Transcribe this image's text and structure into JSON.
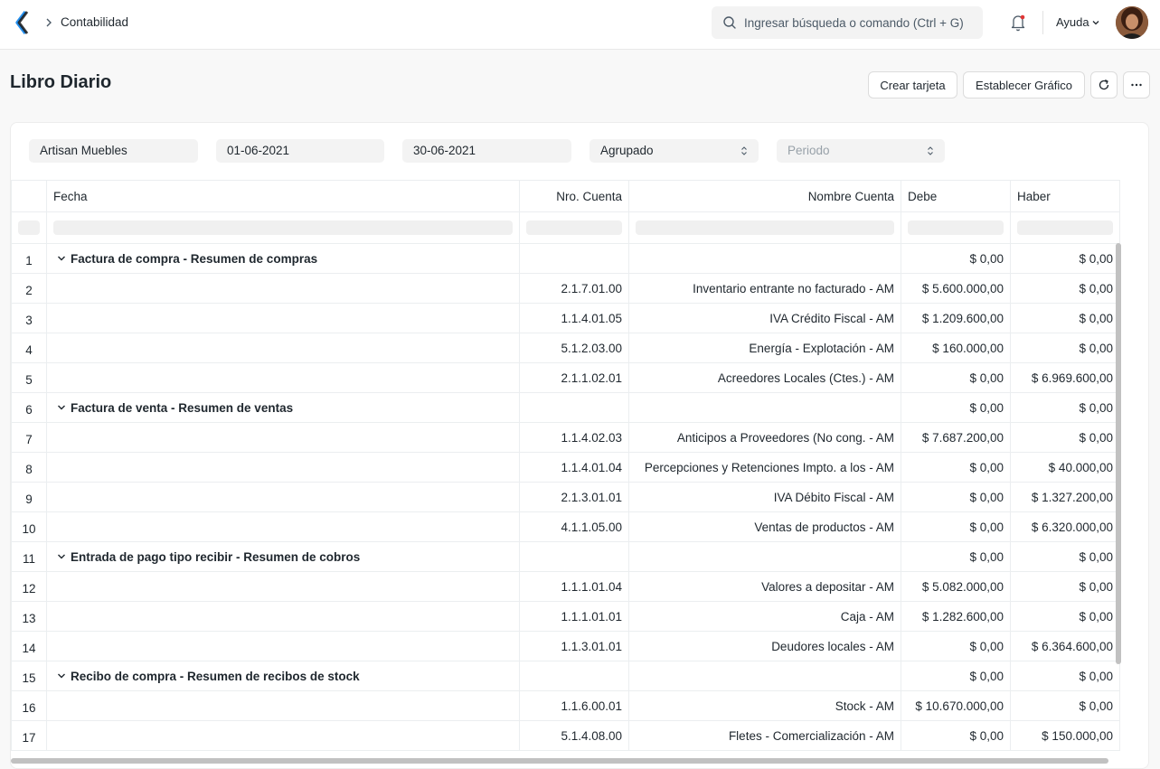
{
  "navbar": {
    "breadcrumb": "Contabilidad",
    "search_placeholder": "Ingresar búsqueda o comando (Ctrl + G)",
    "help_label": "Ayuda",
    "colors": {
      "brand": "#2490ef",
      "accent": "#171717"
    }
  },
  "page": {
    "title": "Libro Diario",
    "buttons": {
      "create_card": "Crear tarjeta",
      "set_chart": "Establecer Gráfico",
      "refresh_icon": "refresh-icon",
      "more_icon": "more-icon"
    }
  },
  "filters": {
    "company": "Artisan Muebles",
    "from_date": "01-06-2021",
    "to_date": "30-06-2021",
    "group_by": "Agrupado",
    "period_placeholder": "Periodo"
  },
  "table": {
    "columns": [
      "Fecha",
      "Nro. Cuenta",
      "Nombre Cuenta",
      "Debe",
      "Haber"
    ],
    "rows": [
      {
        "n": "1",
        "fecha": "Factura de compra - Resumen de compras",
        "cuenta": "",
        "nombre": "",
        "debe": "$ 0,00",
        "haber": "$ 0,00"
      },
      {
        "n": "2",
        "fecha": "",
        "cuenta": "2.1.7.01.00",
        "nombre": "Inventario entrante no facturado - AM",
        "debe": "$ 5.600.000,00",
        "haber": "$ 0,00"
      },
      {
        "n": "3",
        "fecha": "",
        "cuenta": "1.1.4.01.05",
        "nombre": "IVA Crédito Fiscal - AM",
        "debe": "$ 1.209.600,00",
        "haber": "$ 0,00"
      },
      {
        "n": "4",
        "fecha": "",
        "cuenta": "5.1.2.03.00",
        "nombre": "Energía - Explotación - AM",
        "debe": "$ 160.000,00",
        "haber": "$ 0,00"
      },
      {
        "n": "5",
        "fecha": "",
        "cuenta": "2.1.1.02.01",
        "nombre": "Acreedores Locales (Ctes.) - AM",
        "debe": "$ 0,00",
        "haber": "$ 6.969.600,00"
      },
      {
        "n": "6",
        "fecha": "Factura de venta - Resumen de ventas",
        "cuenta": "",
        "nombre": "",
        "debe": "$ 0,00",
        "haber": "$ 0,00"
      },
      {
        "n": "7",
        "fecha": "",
        "cuenta": "1.1.4.02.03",
        "nombre": "Anticipos a Proveedores (No cong. - AM",
        "debe": "$ 7.687.200,00",
        "haber": "$ 0,00"
      },
      {
        "n": "8",
        "fecha": "",
        "cuenta": "1.1.4.01.04",
        "nombre": "Percepciones y Retenciones Impto. a los - AM",
        "debe": "$ 0,00",
        "haber": "$ 40.000,00"
      },
      {
        "n": "9",
        "fecha": "",
        "cuenta": "2.1.3.01.01",
        "nombre": "IVA Débito Fiscal - AM",
        "debe": "$ 0,00",
        "haber": "$ 1.327.200,00"
      },
      {
        "n": "10",
        "fecha": "",
        "cuenta": "4.1.1.05.00",
        "nombre": "Ventas de productos - AM",
        "debe": "$ 0,00",
        "haber": "$ 6.320.000,00"
      },
      {
        "n": "11",
        "fecha": "Entrada de pago tipo recibir - Resumen de cobros",
        "cuenta": "",
        "nombre": "",
        "debe": "$ 0,00",
        "haber": "$ 0,00"
      },
      {
        "n": "12",
        "fecha": "",
        "cuenta": "1.1.1.01.04",
        "nombre": "Valores a depositar - AM",
        "debe": "$ 5.082.000,00",
        "haber": "$ 0,00"
      },
      {
        "n": "13",
        "fecha": "",
        "cuenta": "1.1.1.01.01",
        "nombre": "Caja - AM",
        "debe": "$ 1.282.600,00",
        "haber": "$ 0,00"
      },
      {
        "n": "14",
        "fecha": "",
        "cuenta": "1.1.3.01.01",
        "nombre": "Deudores locales - AM",
        "debe": "$ 0,00",
        "haber": "$ 6.364.600,00"
      },
      {
        "n": "15",
        "fecha": "Recibo de compra - Resumen de recibos de stock",
        "cuenta": "",
        "nombre": "",
        "debe": "$ 0,00",
        "haber": "$ 0,00"
      },
      {
        "n": "16",
        "fecha": "",
        "cuenta": "1.1.6.00.01",
        "nombre": "Stock - AM",
        "debe": "$ 10.670.000,00",
        "haber": "$ 0,00"
      },
      {
        "n": "17",
        "fecha": "",
        "cuenta": "5.1.4.08.00",
        "nombre": "Fletes - Comercialización - AM",
        "debe": "$ 0,00",
        "haber": "$ 150.000,00"
      }
    ]
  }
}
